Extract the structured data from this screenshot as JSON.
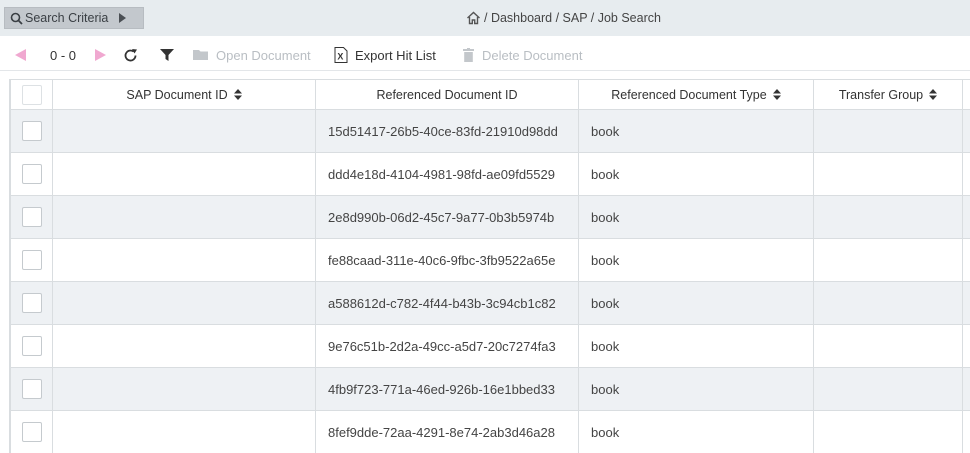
{
  "topbar": {
    "search_criteria_label": "Search Criteria",
    "breadcrumb": "/ Dashboard / SAP / Job Search"
  },
  "toolbar": {
    "page_range": "0 - 0",
    "open_document": "Open Document",
    "export_hit_list": "Export Hit List",
    "delete_document": "Delete Document"
  },
  "colors": {
    "nav_arrow_accent": "#f0a8d0",
    "topbar_bg": "#e7ecef",
    "row_stripe": "#eef1f4"
  },
  "icons": [
    "search-icon",
    "chevron-right-icon",
    "home-icon",
    "prev-page-icon",
    "next-page-icon",
    "refresh-icon",
    "filter-icon",
    "folder-icon",
    "excel-icon",
    "trash-icon",
    "sort-icon"
  ],
  "table": {
    "columns": [
      "SAP Document ID",
      "Referenced Document ID",
      "Referenced Document Type",
      "Transfer Group"
    ],
    "rows": [
      {
        "sap_id": "",
        "ref_id": "15d51417-26b5-40ce-83fd-21910d98dd",
        "type": "book",
        "group": ""
      },
      {
        "sap_id": "",
        "ref_id": "ddd4e18d-4104-4981-98fd-ae09fd5529",
        "type": "book",
        "group": ""
      },
      {
        "sap_id": "",
        "ref_id": "2e8d990b-06d2-45c7-9a77-0b3b5974b",
        "type": "book",
        "group": ""
      },
      {
        "sap_id": "",
        "ref_id": "fe88caad-311e-40c6-9fbc-3fb9522a65e",
        "type": "book",
        "group": ""
      },
      {
        "sap_id": "",
        "ref_id": "a588612d-c782-4f44-b43b-3c94cb1c82",
        "type": "book",
        "group": ""
      },
      {
        "sap_id": "",
        "ref_id": "9e76c51b-2d2a-49cc-a5d7-20c7274fa3",
        "type": "book",
        "group": ""
      },
      {
        "sap_id": "",
        "ref_id": "4fb9f723-771a-46ed-926b-16e1bbed33",
        "type": "book",
        "group": ""
      },
      {
        "sap_id": "",
        "ref_id": "8fef9dde-72aa-4291-8e74-2ab3d46a28",
        "type": "book",
        "group": ""
      }
    ]
  }
}
